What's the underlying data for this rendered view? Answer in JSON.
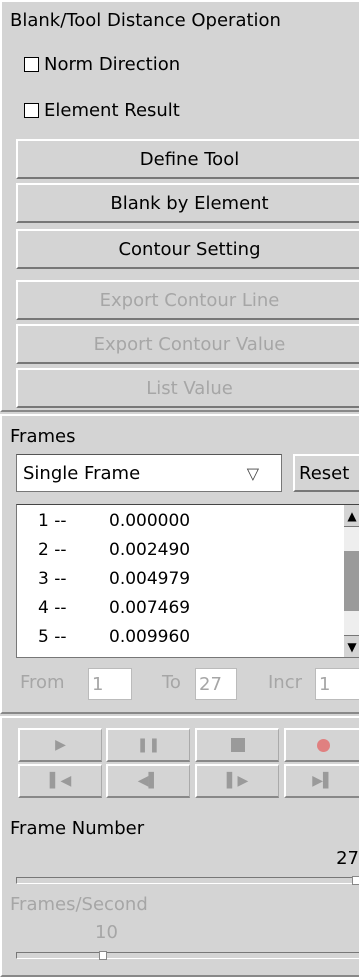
{
  "section1": {
    "title": "Blank/Tool Distance Operation",
    "norm_direction": {
      "label": "Norm Direction",
      "checked": false
    },
    "element_result": {
      "label": "Element Result",
      "checked": false
    },
    "buttons": {
      "define_tool": "Define Tool",
      "blank_by_element": "Blank by Element",
      "contour_setting": "Contour Setting",
      "export_contour_line": "Export Contour Line",
      "export_contour_value": "Export Contour Value",
      "list_value": "List Value"
    }
  },
  "frames": {
    "title": "Frames",
    "mode_select": "Single Frame",
    "reset_label": "Reset",
    "list": [
      {
        "index": "1 --",
        "value": "0.000000"
      },
      {
        "index": "2 --",
        "value": "0.002490"
      },
      {
        "index": "3 --",
        "value": "0.004979"
      },
      {
        "index": "4 --",
        "value": "0.007469"
      },
      {
        "index": "5 --",
        "value": "0.009960"
      }
    ],
    "from_label": "From",
    "from_value": "1",
    "to_label": "To",
    "to_value": "27",
    "incr_label": "Incr",
    "incr_value": "1"
  },
  "playback": {
    "buttons": [
      "play-icon",
      "pause-icon",
      "stop-icon",
      "record-icon",
      "first-frame-icon",
      "step-back-icon",
      "step-forward-icon",
      "last-frame-icon"
    ],
    "frame_number_label": "Frame Number",
    "frame_number_value": "27",
    "frames_per_second_label": "Frames/Second",
    "frames_per_second_value": "10"
  },
  "colors": {
    "panel_bg": "#d4d4d4",
    "disabled_text": "#a6a6a6",
    "record": "#e06060"
  }
}
